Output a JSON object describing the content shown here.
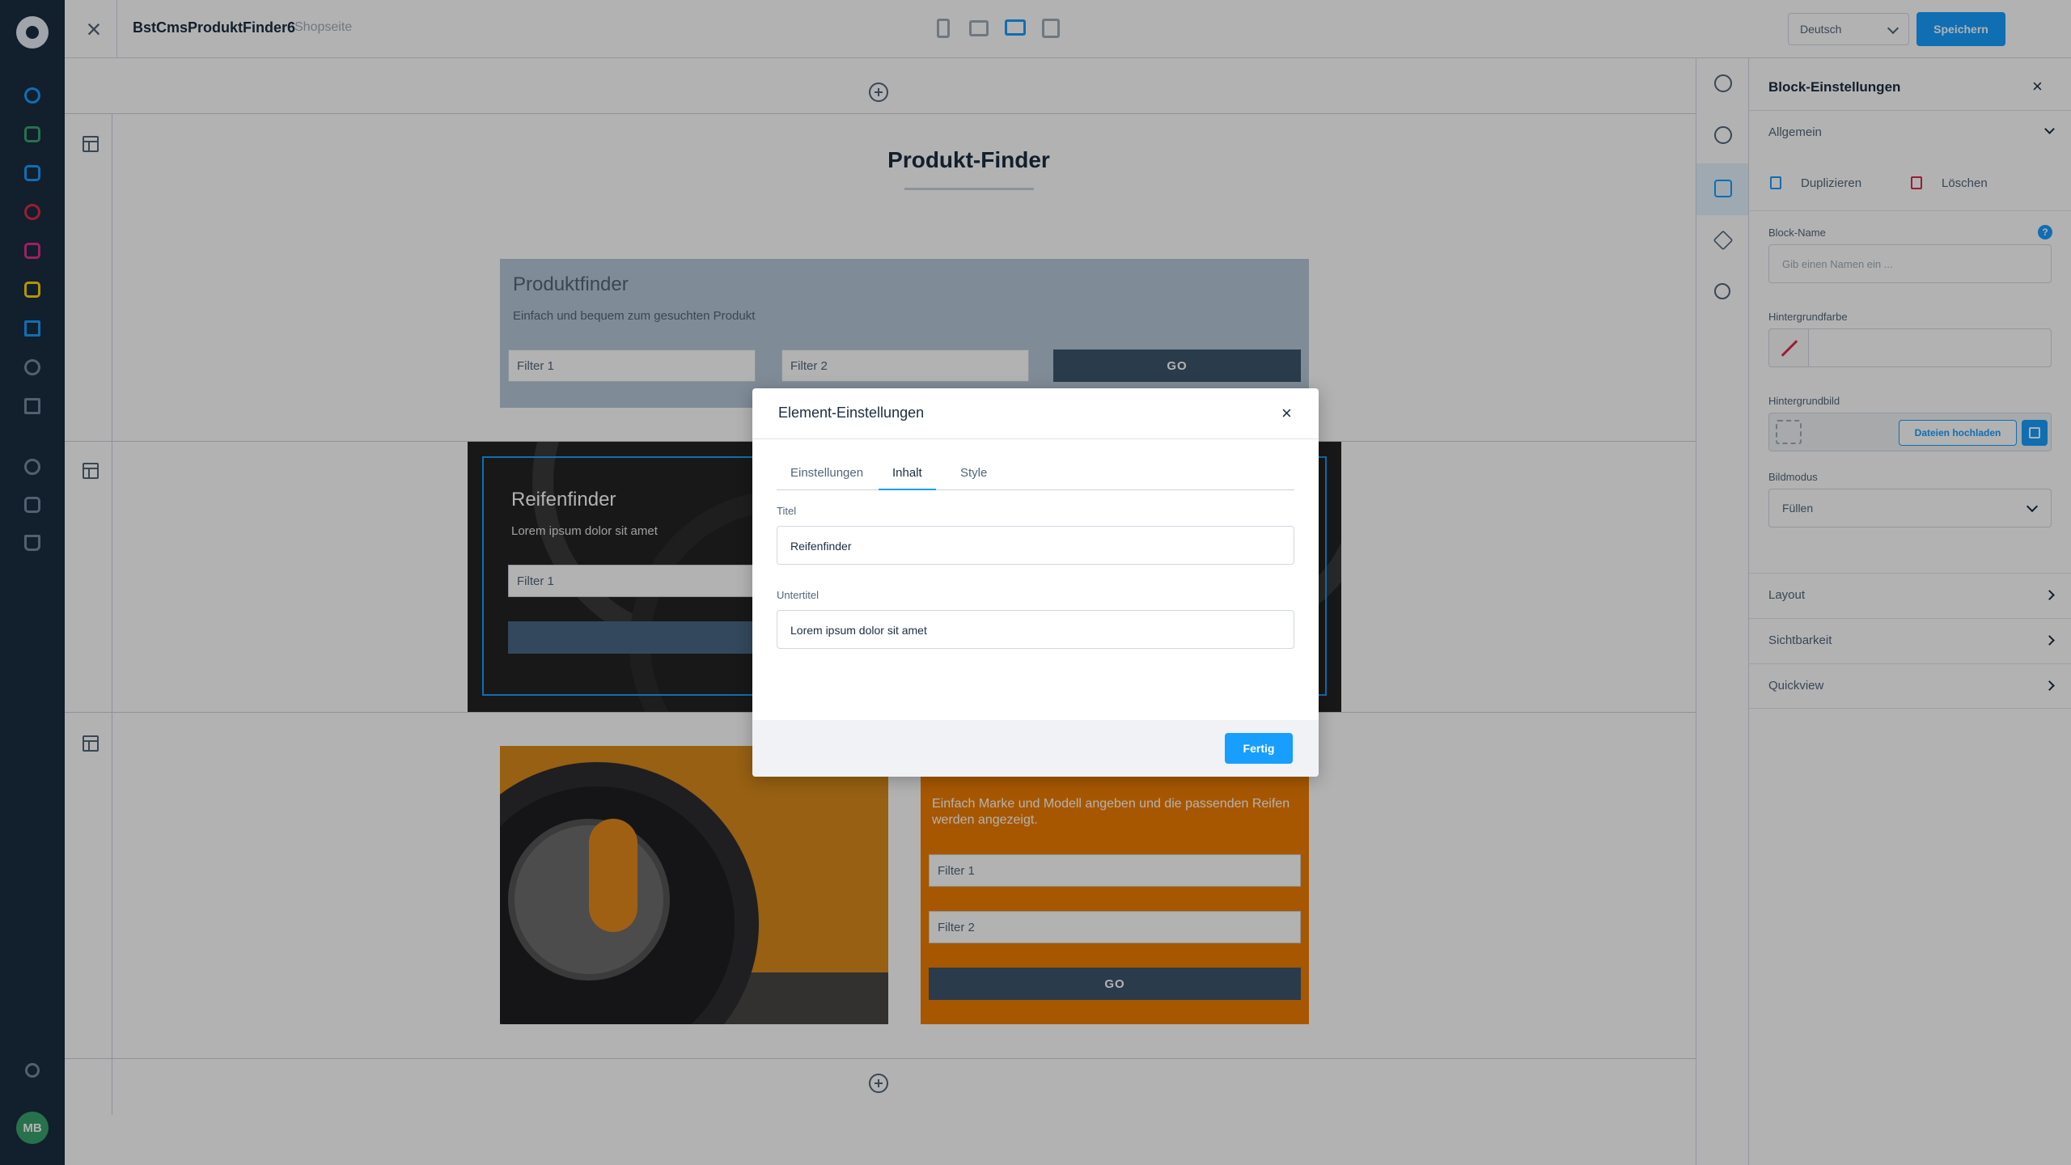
{
  "topbar": {
    "page_name": "BstCmsProduktFinder6",
    "page_type": "Shopseite",
    "language": "Deutsch",
    "save_label": "Speichern"
  },
  "canvas": {
    "heading": "Produkt-Finder",
    "produktfinder": {
      "title": "Produktfinder",
      "subtitle": "Einfach und bequem zum gesuchten Produkt",
      "filter1": "Filter 1",
      "filter2": "Filter 2",
      "go": "GO"
    },
    "reifenfinder": {
      "title": "Reifenfinder",
      "subtitle": "Lorem ipsum dolor sit amet",
      "filter1": "Filter 1"
    },
    "orange_block": {
      "text": "Einfach Marke und Modell angeben und die passenden Reifen werden angezeigt.",
      "filter1": "Filter 1",
      "filter2": "Filter 2",
      "go": "GO"
    }
  },
  "sidebar": {
    "title": "Block-Einstellungen",
    "close": "×",
    "sections": {
      "general": "Allgemein",
      "layout": "Layout",
      "visibility": "Sichtbarkeit",
      "quickview": "Quickview"
    },
    "duplicate": "Duplizieren",
    "delete": "Löschen",
    "block_name_label": "Block-Name",
    "block_name_placeholder": "Gib einen Namen ein ...",
    "help": "?",
    "bg_color_label": "Hintergrundfarbe",
    "bg_image_label": "Hintergrundbild",
    "upload_label": "Dateien hochladen",
    "image_mode_label": "Bildmodus",
    "image_mode_value": "Füllen"
  },
  "modal": {
    "title": "Element-Einstellungen",
    "close": "×",
    "tabs": [
      "Einstellungen",
      "Inhalt",
      "Style"
    ],
    "active_tab": "Inhalt",
    "title_label": "Titel",
    "title_value": "Reifenfinder",
    "subtitle_label": "Untertitel",
    "subtitle_value": "Lorem ipsum dolor sit amet",
    "done": "Fertig"
  },
  "user": {
    "initials": "MB"
  },
  "colors": {
    "nav_bg": "#1b2d40",
    "accent": "#189eff",
    "orange": "#ef7d00",
    "danger": "#de294c",
    "success": "#3aa36f"
  },
  "icons": {
    "nav": [
      "dashboard-icon",
      "catalogue-icon",
      "orders-icon",
      "customers-icon",
      "content-icon",
      "marketing-icon",
      "extensions-icon",
      "settings-icon",
      "apps-icon",
      "add-icon",
      "calculator-icon",
      "basket-icon",
      "info-icon"
    ],
    "rail": [
      "gear-icon",
      "add-icon",
      "edit-icon",
      "layers-icon",
      "share-icon"
    ]
  }
}
